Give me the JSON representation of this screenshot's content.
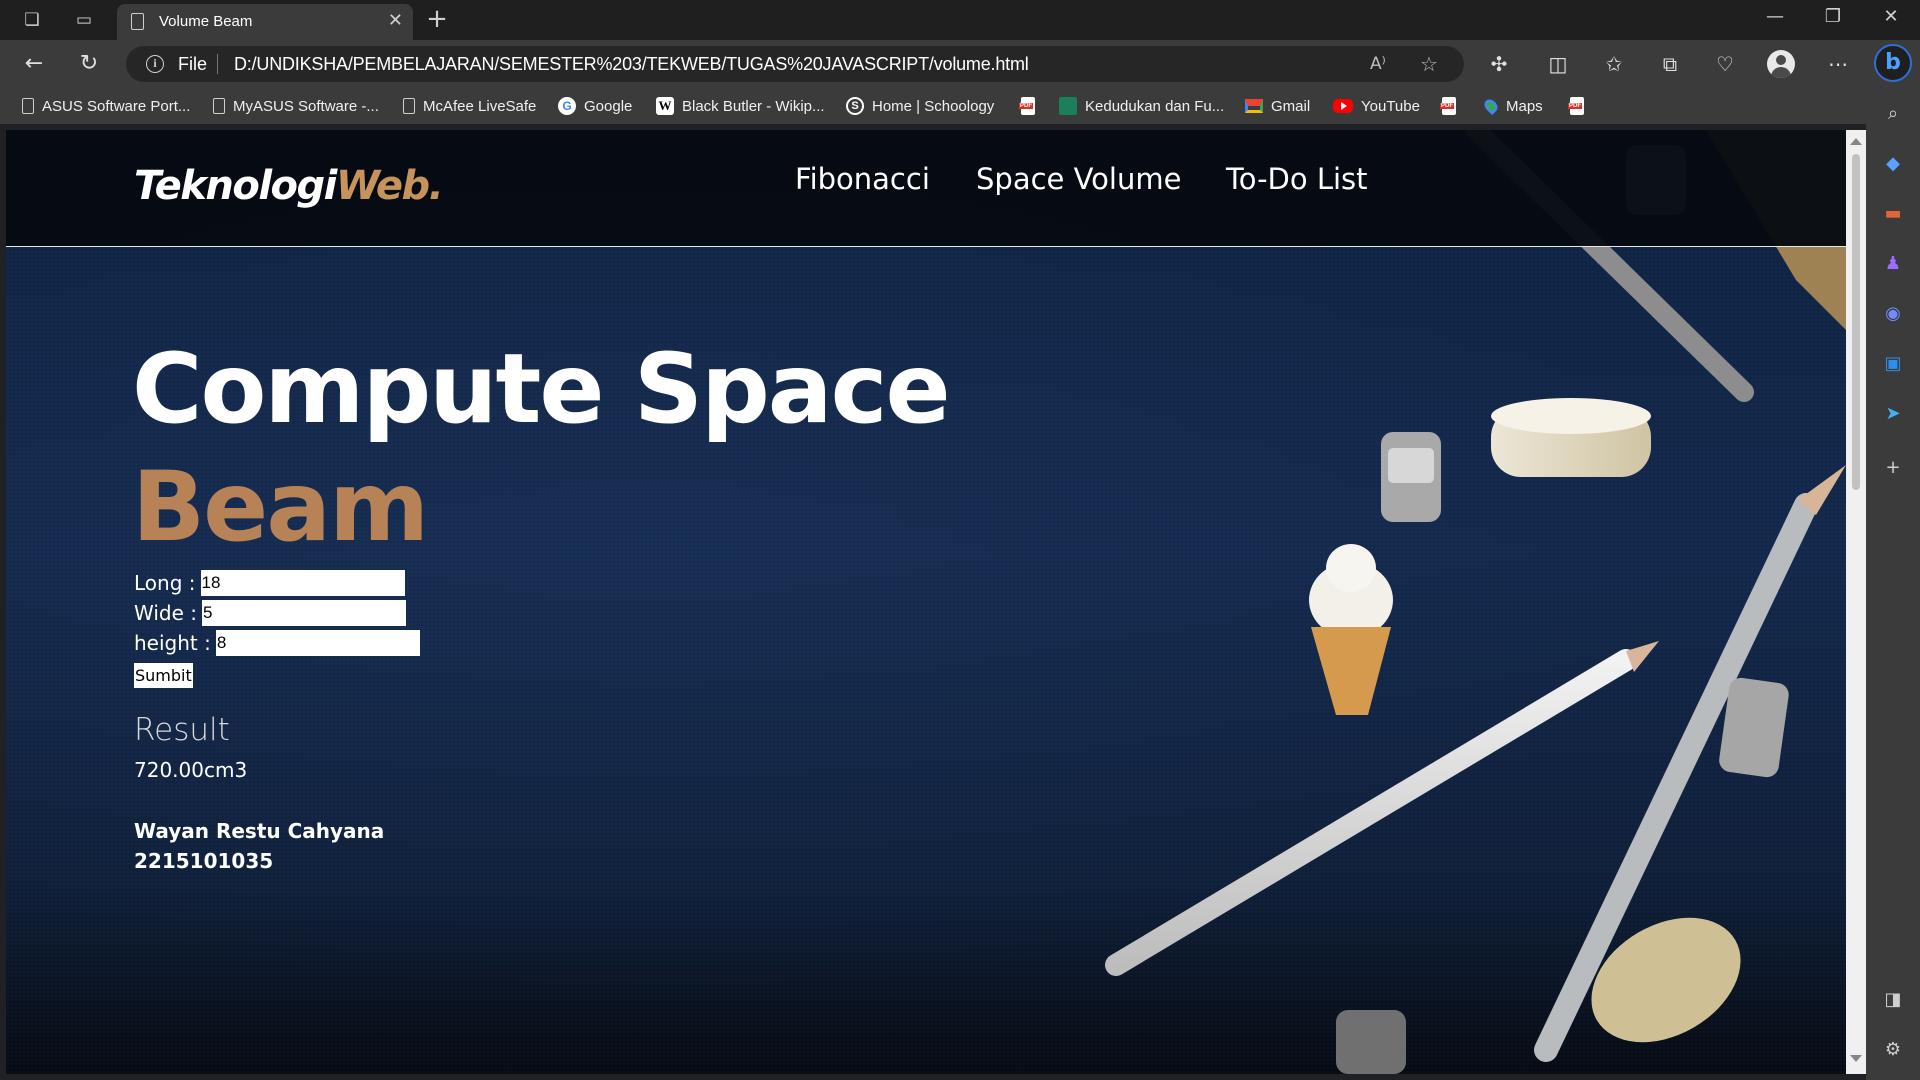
{
  "browser": {
    "tab_title": "Volume Beam",
    "address_scheme": "File",
    "address_url": "D:/UNDIKSHA/PEMBELAJARAN/SEMESTER%203/TEKWEB/TUGAS%20JAVASCRIPT/volume.html",
    "bookmarks": [
      {
        "label": "ASUS Software Port...",
        "icon": "page-icon"
      },
      {
        "label": "MyASUS Software -...",
        "icon": "page-icon"
      },
      {
        "label": "McAfee LiveSafe",
        "icon": "page-icon"
      },
      {
        "label": "Google",
        "icon": "google-icon"
      },
      {
        "label": "Black Butler - Wikip...",
        "icon": "wikipedia-icon"
      },
      {
        "label": "Home | Schoology",
        "icon": "schoology-icon"
      },
      {
        "label": "",
        "icon": "pdf-icon"
      },
      {
        "label": "Kedudukan dan Fu...",
        "icon": "site-icon"
      },
      {
        "label": "Gmail",
        "icon": "gmail-icon"
      },
      {
        "label": "YouTube",
        "icon": "youtube-icon"
      },
      {
        "label": "",
        "icon": "pdf-icon"
      },
      {
        "label": "Maps",
        "icon": "maps-icon"
      },
      {
        "label": "",
        "icon": "pdf-icon"
      }
    ]
  },
  "site": {
    "logo_main": "Teknologi",
    "logo_accent": "Web.",
    "nav": [
      "Fibonacci",
      "Space Volume",
      "To-Do List"
    ],
    "title_line1": "Compute Space",
    "title_line2": "Beam",
    "form": {
      "long_label": "Long :",
      "long_value": "18",
      "wide_label": "Wide :",
      "wide_value": "5",
      "height_label": "height :",
      "height_value": "8",
      "submit_label": "Sumbit"
    },
    "result_label": "Result",
    "result_value": "720.00cm3",
    "author_name": "Wayan Restu Cahyana",
    "author_id": "2215101035"
  },
  "colors": {
    "accent": "#b78356",
    "logo_accent": "#c7935c",
    "background": "#13284b",
    "browser_bg": "#3b3b3b"
  }
}
